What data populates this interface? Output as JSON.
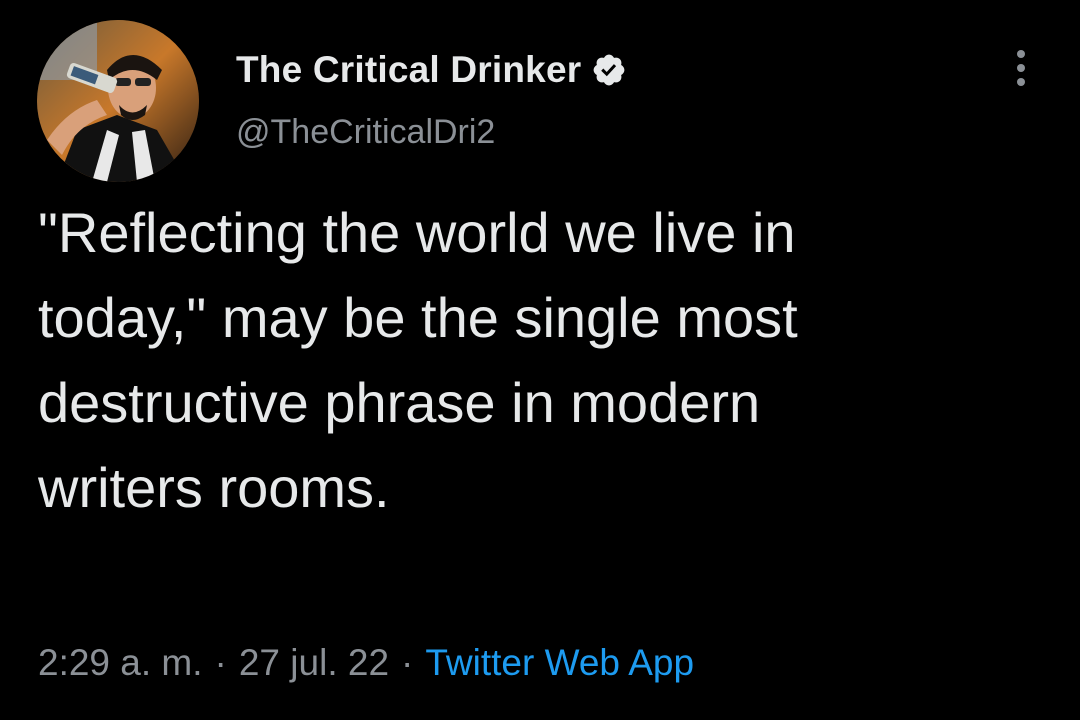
{
  "tweet": {
    "display_name": "The Critical Drinker",
    "handle": "@TheCriticalDri2",
    "verified": true,
    "text": "\"Reflecting the world we live in\ntoday,\" may be the single most\ndestructive phrase in modern\nwriters rooms.",
    "time": "2:29 a. m.",
    "separator": "·",
    "date": "27 jul. 22",
    "source": "Twitter Web App"
  },
  "icons": {
    "verified": "verified-badge-icon",
    "more": "more-options-icon"
  },
  "colors": {
    "background": "#000000",
    "primary_text": "#e7e9ea",
    "secondary_text": "#8b9096",
    "link": "#1d9bf0"
  }
}
